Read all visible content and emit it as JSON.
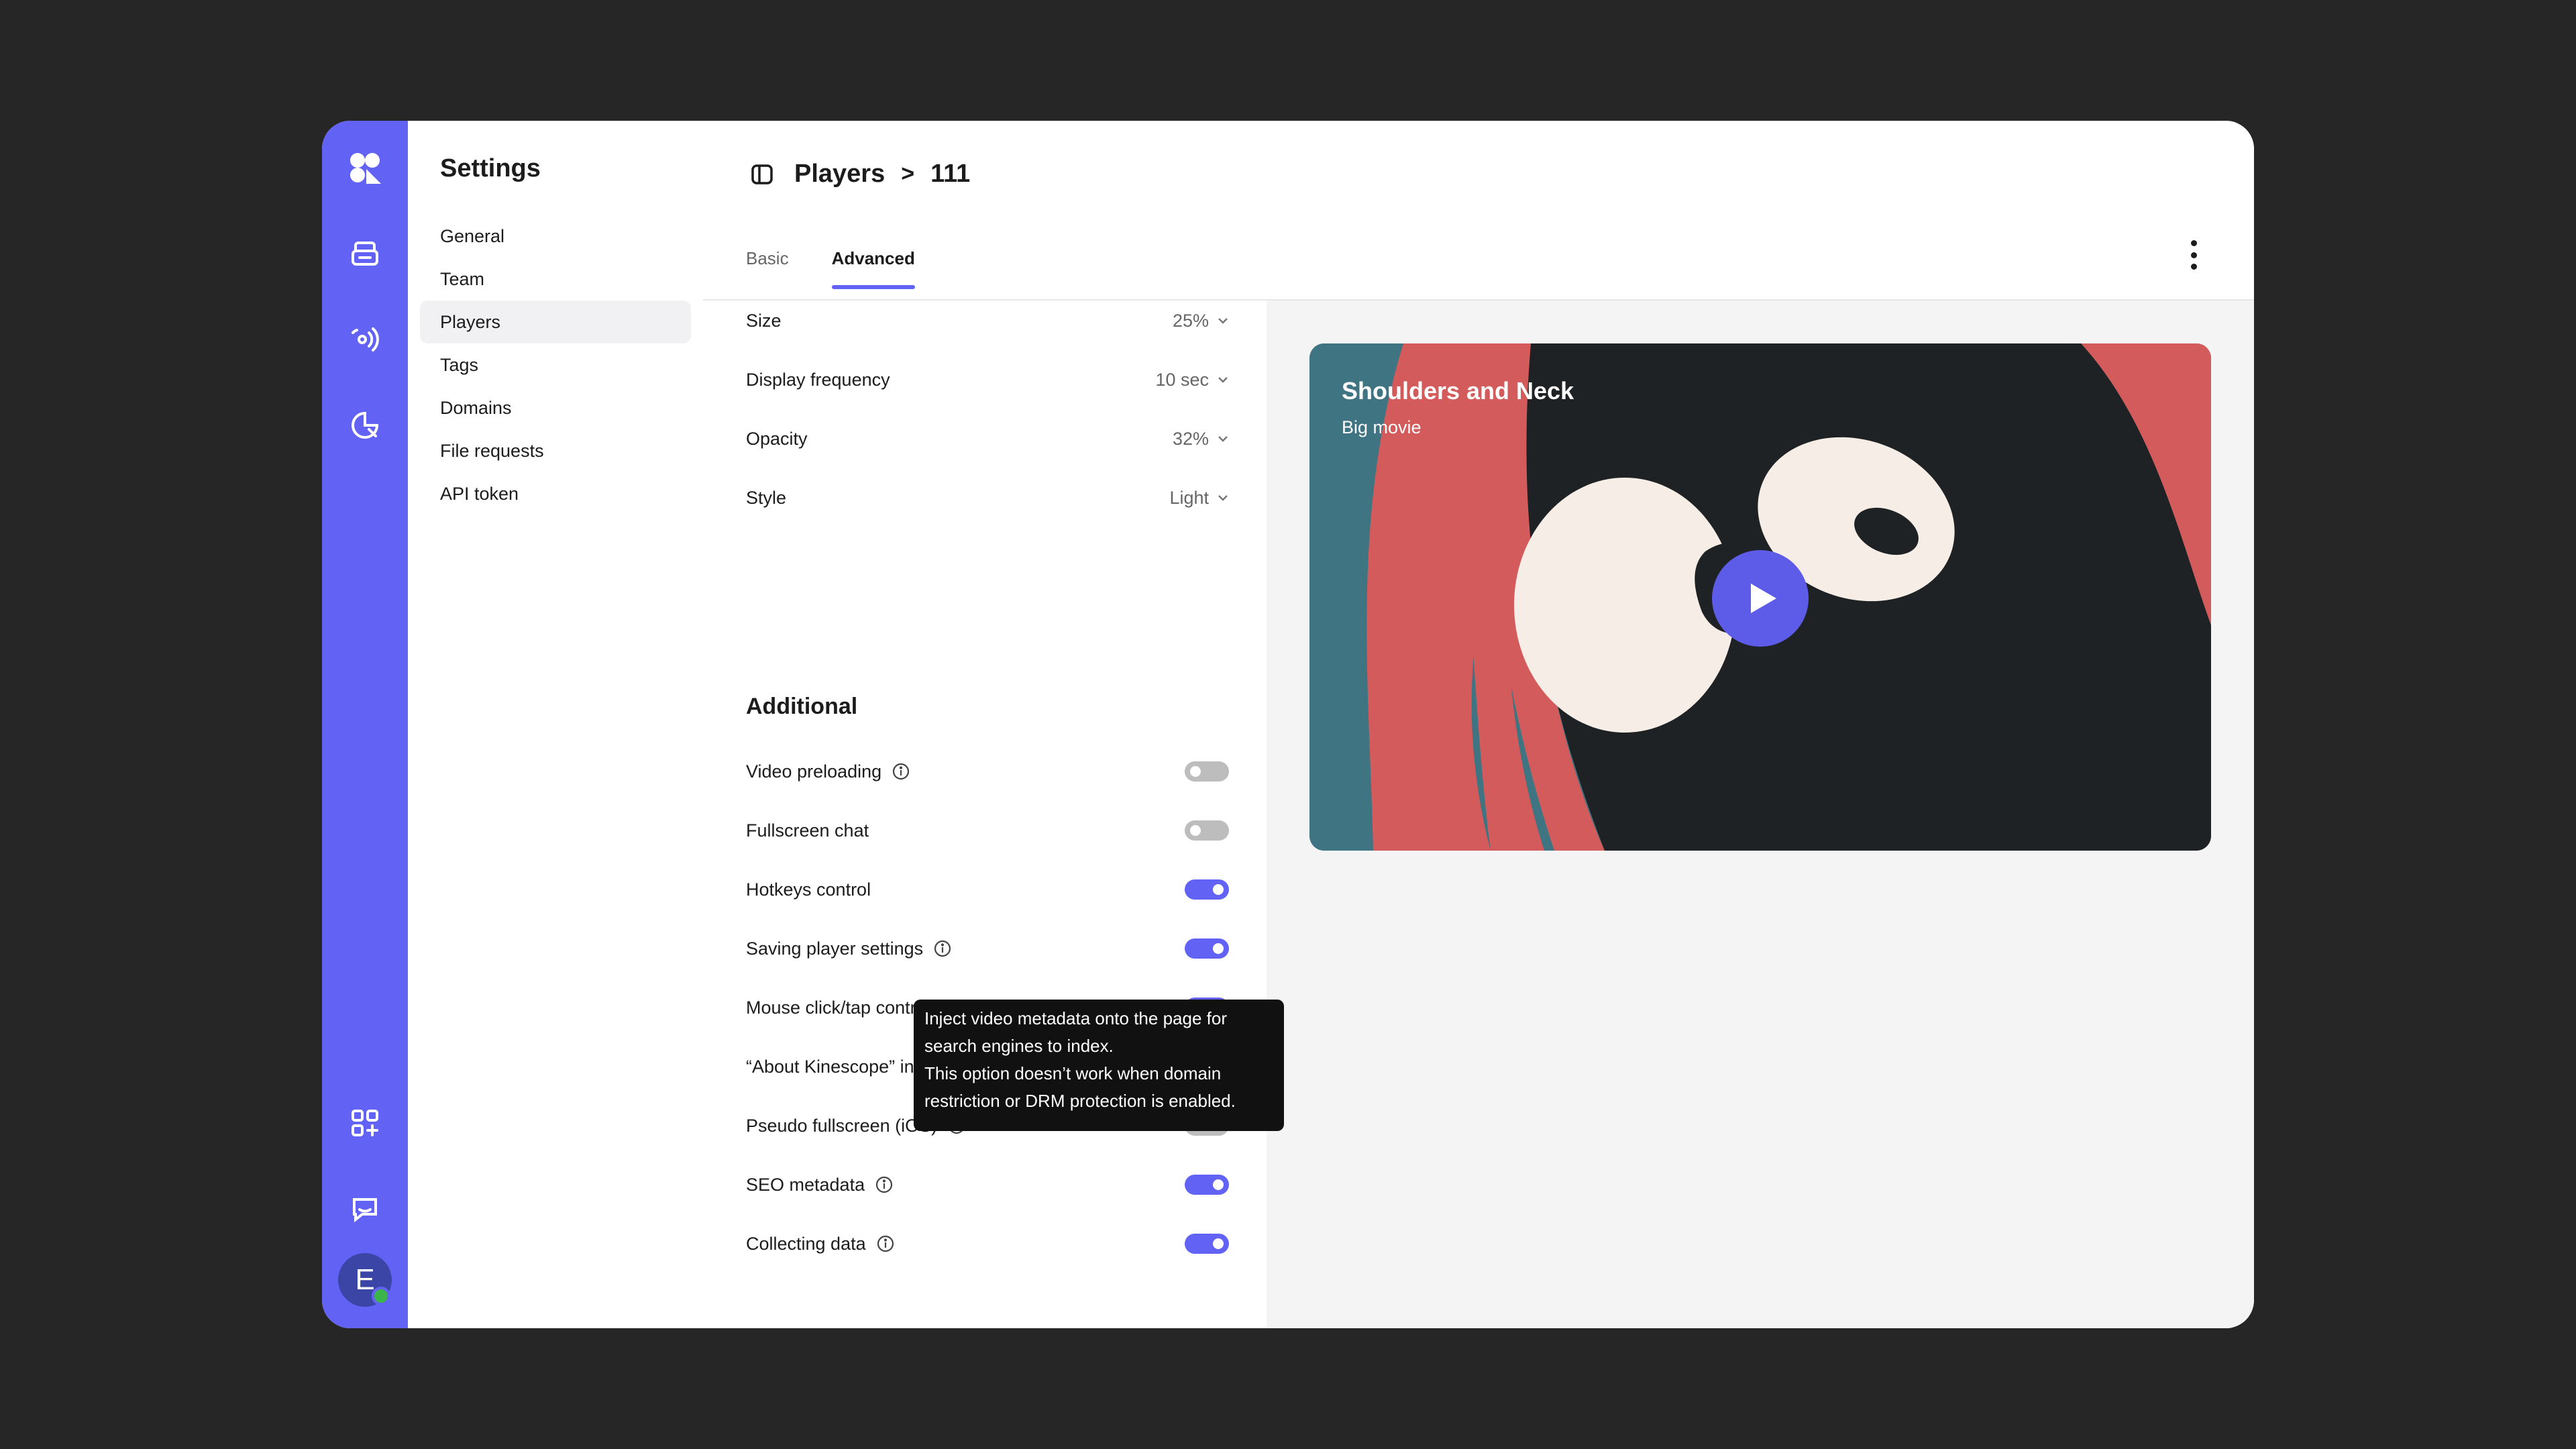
{
  "rail": {
    "icons": [
      "logo-icon",
      "folder-icon",
      "broadcast-icon",
      "analytics-icon",
      "add-apps-icon",
      "chat-icon"
    ],
    "avatar_initial": "E",
    "accent": "#6262f5"
  },
  "settings_nav": {
    "title": "Settings",
    "items": [
      {
        "label": "General"
      },
      {
        "label": "Team"
      },
      {
        "label": "Players",
        "active": true
      },
      {
        "label": "Tags"
      },
      {
        "label": "Domains"
      },
      {
        "label": "File requests"
      },
      {
        "label": "API token"
      }
    ]
  },
  "header": {
    "breadcrumb": [
      "Players",
      "111"
    ],
    "separator": ">",
    "tabs": [
      {
        "label": "Basic"
      },
      {
        "label": "Advanced",
        "active": true
      }
    ]
  },
  "form": {
    "dropdowns": [
      {
        "label": "Size",
        "value": "25%"
      },
      {
        "label": "Display frequency",
        "value": "10 sec"
      },
      {
        "label": "Opacity",
        "value": "32%"
      },
      {
        "label": "Style",
        "value": "Light"
      }
    ],
    "section_title": "Additional",
    "toggles": [
      {
        "label": "Video preloading",
        "info": true,
        "on": false
      },
      {
        "label": "Fullscreen chat",
        "info": false,
        "on": false
      },
      {
        "label": "Hotkeys control",
        "info": false,
        "on": true
      },
      {
        "label": "Saving player settings",
        "info": true,
        "on": true
      },
      {
        "label": "Mouse click/tap control",
        "info": false,
        "on": true
      },
      {
        "label": "“About Kinescope” in the right-click menu",
        "info": true,
        "on": true
      },
      {
        "label": "Pseudo fullscreen (iOS)",
        "info": true,
        "on": false
      },
      {
        "label": "SEO metadata",
        "info": true,
        "on": true
      },
      {
        "label": "Collecting data",
        "info": true,
        "on": true
      }
    ]
  },
  "preview": {
    "title": "Shoulders and Neck",
    "subtitle": "Big movie"
  },
  "tooltip": {
    "lines": [
      "Inject video metadata onto the page for",
      "search engines to index.",
      "This option doesn’t work when domain",
      "restriction or DRM protection is enabled."
    ]
  }
}
